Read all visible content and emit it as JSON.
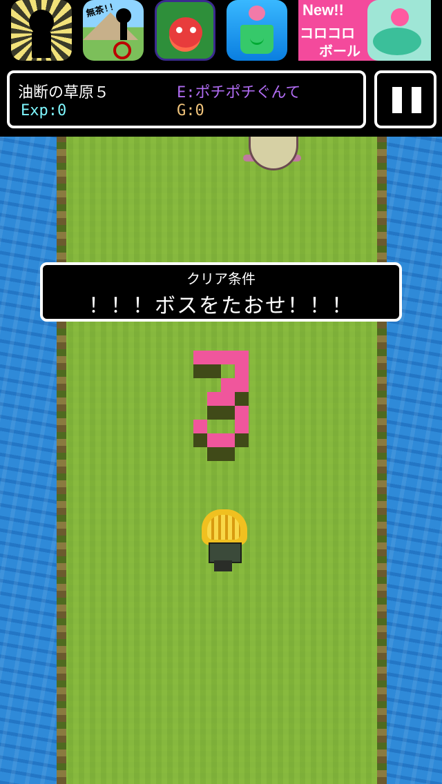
{
  "ads": {
    "icons": [
      {
        "name": "ad-runner-game"
      },
      {
        "name": "ad-unicycle-game",
        "caption": "無茶!!"
      },
      {
        "name": "ad-dragon-puzzle-game"
      },
      {
        "name": "ad-watering-pot-game"
      }
    ],
    "banner": {
      "new_label": "New!!",
      "line1": "コロコロ",
      "line2": "ボール"
    }
  },
  "hud": {
    "stage_name": "油断の草原５",
    "enemy_label": "E:ポチポチぐんて",
    "exp_label": "Exp:0",
    "gold_label": "G:0"
  },
  "clear_condition": {
    "title": "クリア条件",
    "text": "！！！ボスをたおせ！！！"
  },
  "countdown": {
    "value": 3
  },
  "colors": {
    "water": "#2f8ad8",
    "grass": "#86b83e",
    "countdown_pink": "#f0569c",
    "enemy_purple": "#b06cf2",
    "exp_cyan": "#7ff7ff",
    "gold_orange": "#f2c57c"
  }
}
